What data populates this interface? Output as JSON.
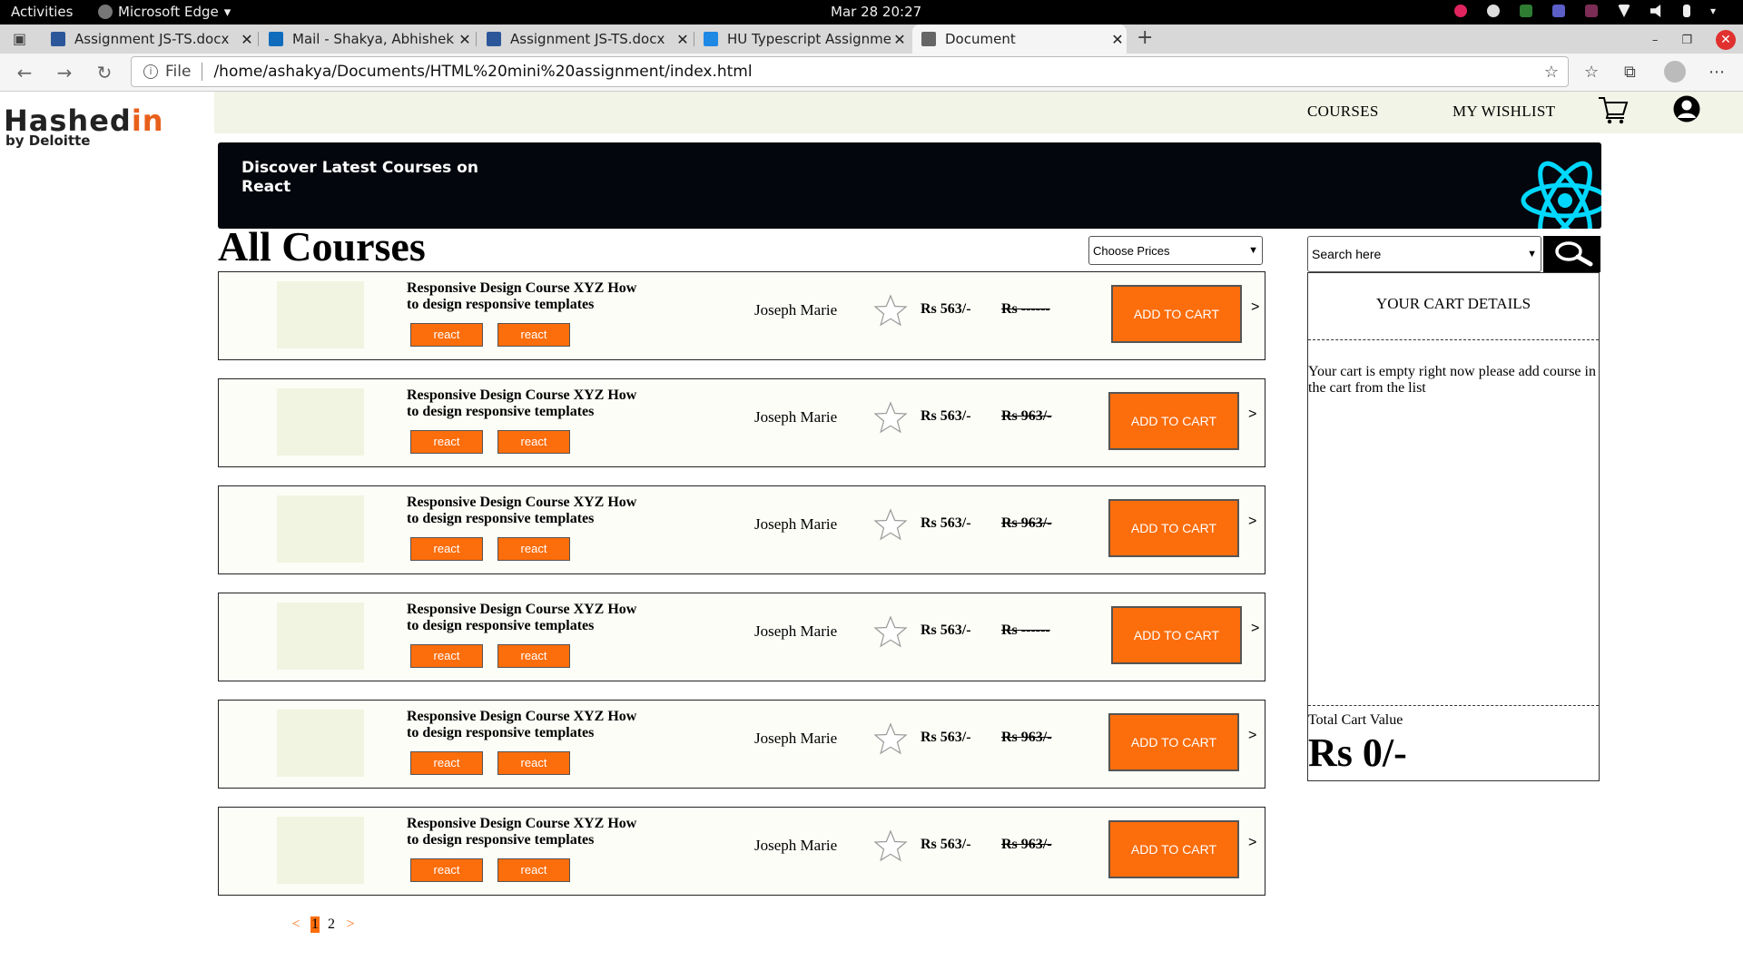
{
  "os": {
    "activities": "Activities",
    "app_name": "Microsoft Edge",
    "clock": "Mar 28  20:27"
  },
  "tabs": [
    {
      "label": "Assignment JS-TS.docx",
      "icon": "word-icon",
      "color": "#2b579a"
    },
    {
      "label": "Mail - Shakya, Abhishek - C",
      "icon": "outlook-icon",
      "color": "#0f6cbd"
    },
    {
      "label": "Assignment JS-TS.docx",
      "icon": "word-icon",
      "color": "#2b579a"
    },
    {
      "label": "HU Typescript Assignmen",
      "icon": "bolt-icon",
      "color": "#1e88e5"
    },
    {
      "label": "Document",
      "icon": "document-icon",
      "color": "#666666"
    }
  ],
  "address": {
    "scheme_label": "File",
    "url": "/home/ashakya/Documents/HTML%20mini%20assignment/index.html"
  },
  "logo": {
    "brand_main": "Hashed",
    "brand_accent": "in",
    "sub": "by Deloitte"
  },
  "nav": {
    "courses": "COURSES",
    "wishlist": "MY WISHLIST"
  },
  "banner": {
    "text": "Discover Latest Courses on React"
  },
  "page": {
    "title": "All Courses"
  },
  "filters": {
    "price_select": "Choose Prices",
    "search_select": "Search here"
  },
  "courses": [
    {
      "title": "Responsive Design Course XYZ How to design responsive templates",
      "tags": [
        "react",
        "react"
      ],
      "author": "Joseph Marie",
      "price": "Rs 563/-",
      "old_price": "Rs ------",
      "button": "ADD TO CART",
      "arrow": ">"
    },
    {
      "title": "Responsive Design Course XYZ How to design responsive templates",
      "tags": [
        "react",
        "react"
      ],
      "author": "Joseph Marie",
      "price": "Rs 563/-",
      "old_price": "Rs 963/-",
      "button": "ADD TO CART",
      "arrow": ">"
    },
    {
      "title": "Responsive Design Course XYZ How to design responsive templates",
      "tags": [
        "react",
        "react"
      ],
      "author": "Joseph Marie",
      "price": "Rs 563/-",
      "old_price": "Rs 963/-",
      "button": "ADD TO CART",
      "arrow": ">"
    },
    {
      "title": "Responsive Design Course XYZ How to design responsive templates",
      "tags": [
        "react",
        "react"
      ],
      "author": "Joseph Marie",
      "price": "Rs 563/-",
      "old_price": "Rs ------",
      "button": "ADD TO CART",
      "arrow": ">"
    },
    {
      "title": "Responsive Design Course XYZ How to design responsive templates",
      "tags": [
        "react",
        "react"
      ],
      "author": "Joseph Marie",
      "price": "Rs 563/-",
      "old_price": "Rs 963/-",
      "button": "ADD TO CART",
      "arrow": ">"
    },
    {
      "title": "Responsive Design Course XYZ How to design responsive templates",
      "tags": [
        "react",
        "react"
      ],
      "author": "Joseph Marie",
      "price": "Rs 563/-",
      "old_price": "Rs 963/-",
      "button": "ADD TO CART",
      "arrow": ">"
    }
  ],
  "pagination": {
    "prev": "<",
    "pages": [
      "1",
      "2"
    ],
    "current": "1",
    "next": ">"
  },
  "cart": {
    "title": "YOUR CART DETAILS",
    "empty_message": "Your cart is empty right now please add course in the cart from the list",
    "total_label": "Total Cart Value",
    "total_value": "Rs 0/-"
  },
  "colors": {
    "accent": "#fc6d0b",
    "nav_bg": "#f1f4e6",
    "banner_bg": "#03060d",
    "react_blue": "#00d8ff"
  }
}
